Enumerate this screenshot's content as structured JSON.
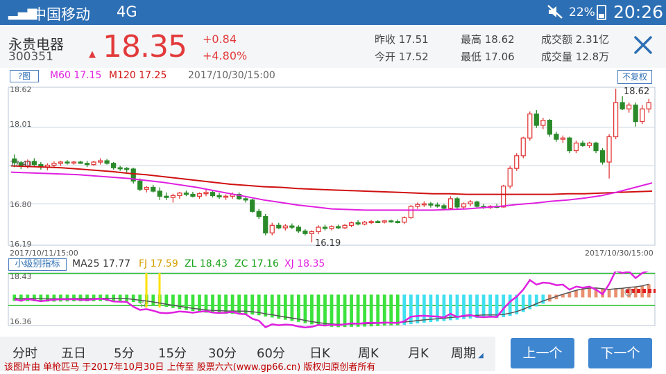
{
  "status_bar": {
    "carrier": "中国移动",
    "network": "4G",
    "battery_pct": "22%",
    "time": "20:26"
  },
  "stock": {
    "name": "永贵电器",
    "code": "300351",
    "price": "18.35",
    "change": "+0.84",
    "change_pct": "+4.80%",
    "prev_close_label": "昨收 17.51",
    "open_label": "今开 17.52",
    "high_label": "最高 18.62",
    "low_label": "最低 17.06",
    "turnover_label": "成交额 2.31亿",
    "volume_label": "成交量 12.8万"
  },
  "ma_bar": {
    "help_label": "?图",
    "m60_label": "M60",
    "m60_value": "17.15",
    "m120_label": "M120",
    "m120_value": "17.25",
    "date": "2017/10/30/15:00",
    "adjust_label": "不复权"
  },
  "main_chart": {
    "y_labels": [
      "18.62",
      "18.01",
      "17.40",
      "16.80",
      "16.19"
    ],
    "start_time": "2017/10/11/15:00",
    "end_time": "2017/10/30/15:00",
    "high_marker": "18.62",
    "low_marker": "16.19"
  },
  "indicator_bar": {
    "button_label": "小级别指标",
    "ma25_label": "MA25",
    "ma25_value": "17.77",
    "fj_label": "FJ",
    "fj_value": "17.59",
    "zl_label": "ZL",
    "zl_value": "18.43",
    "zc_label": "ZC",
    "zc_value": "17.16",
    "xj_label": "XJ",
    "xj_value": "18.35",
    "y_top": "18.43",
    "y_bottom": "16.36"
  },
  "tabs": [
    "分时",
    "五日",
    "5分",
    "15分",
    "30分",
    "60分",
    "日K",
    "周K",
    "月K",
    "周期"
  ],
  "buttons": {
    "prev": "上一个",
    "next": "下一个"
  },
  "watermark": "该图片由 单枪匹马 于2017年10月30日 上传至 股票六六(www.gp66.cn) 版权归原创者所有",
  "colors": {
    "up": "#e23a3a",
    "down": "#2a8a2a",
    "m60": "#e020e0",
    "m120": "#d01010",
    "brand": "#2d6fb4"
  },
  "chart_data": {
    "type": "candlestick",
    "interval": "60分",
    "ylim": [
      16.19,
      18.62
    ],
    "candles": [
      {
        "o": 17.51,
        "h": 17.58,
        "l": 17.38,
        "c": 17.45
      },
      {
        "o": 17.45,
        "h": 17.48,
        "l": 17.35,
        "c": 17.4
      },
      {
        "o": 17.4,
        "h": 17.5,
        "l": 17.36,
        "c": 17.47
      },
      {
        "o": 17.47,
        "h": 17.52,
        "l": 17.4,
        "c": 17.42
      },
      {
        "o": 17.42,
        "h": 17.46,
        "l": 17.34,
        "c": 17.38
      },
      {
        "o": 17.38,
        "h": 17.44,
        "l": 17.33,
        "c": 17.41
      },
      {
        "o": 17.41,
        "h": 17.47,
        "l": 17.38,
        "c": 17.44
      },
      {
        "o": 17.44,
        "h": 17.48,
        "l": 17.4,
        "c": 17.46
      },
      {
        "o": 17.46,
        "h": 17.49,
        "l": 17.42,
        "c": 17.45
      },
      {
        "o": 17.45,
        "h": 17.48,
        "l": 17.42,
        "c": 17.46
      },
      {
        "o": 17.46,
        "h": 17.48,
        "l": 17.43,
        "c": 17.44
      },
      {
        "o": 17.44,
        "h": 17.48,
        "l": 17.38,
        "c": 17.42
      },
      {
        "o": 17.42,
        "h": 17.48,
        "l": 17.4,
        "c": 17.46
      },
      {
        "o": 17.46,
        "h": 17.52,
        "l": 17.42,
        "c": 17.48
      },
      {
        "o": 17.48,
        "h": 17.51,
        "l": 17.42,
        "c": 17.44
      },
      {
        "o": 17.44,
        "h": 17.46,
        "l": 17.34,
        "c": 17.37
      },
      {
        "o": 17.37,
        "h": 17.4,
        "l": 17.32,
        "c": 17.36
      },
      {
        "o": 17.36,
        "h": 17.38,
        "l": 17.3,
        "c": 17.35
      },
      {
        "o": 17.35,
        "h": 17.37,
        "l": 17.12,
        "c": 17.16
      },
      {
        "o": 17.16,
        "h": 17.2,
        "l": 17.0,
        "c": 17.03
      },
      {
        "o": 17.03,
        "h": 17.08,
        "l": 16.98,
        "c": 17.06
      },
      {
        "o": 17.06,
        "h": 17.1,
        "l": 16.98,
        "c": 17.0
      },
      {
        "o": 17.0,
        "h": 17.06,
        "l": 16.86,
        "c": 16.92
      },
      {
        "o": 16.92,
        "h": 16.98,
        "l": 16.86,
        "c": 16.9
      },
      {
        "o": 16.9,
        "h": 16.96,
        "l": 16.82,
        "c": 16.93
      },
      {
        "o": 16.93,
        "h": 16.99,
        "l": 16.88,
        "c": 16.97
      },
      {
        "o": 16.97,
        "h": 17.01,
        "l": 16.92,
        "c": 16.95
      },
      {
        "o": 16.95,
        "h": 16.99,
        "l": 16.9,
        "c": 16.92
      },
      {
        "o": 16.92,
        "h": 16.98,
        "l": 16.88,
        "c": 16.96
      },
      {
        "o": 16.96,
        "h": 17.02,
        "l": 16.92,
        "c": 16.98
      },
      {
        "o": 16.98,
        "h": 17.0,
        "l": 16.9,
        "c": 16.93
      },
      {
        "o": 16.93,
        "h": 16.97,
        "l": 16.88,
        "c": 16.91
      },
      {
        "o": 16.91,
        "h": 16.95,
        "l": 16.86,
        "c": 16.92
      },
      {
        "o": 16.92,
        "h": 16.98,
        "l": 16.88,
        "c": 16.95
      },
      {
        "o": 16.95,
        "h": 16.98,
        "l": 16.86,
        "c": 16.88
      },
      {
        "o": 16.88,
        "h": 16.92,
        "l": 16.82,
        "c": 16.86
      },
      {
        "o": 16.86,
        "h": 16.88,
        "l": 16.66,
        "c": 16.68
      },
      {
        "o": 16.68,
        "h": 16.72,
        "l": 16.56,
        "c": 16.6
      },
      {
        "o": 16.6,
        "h": 16.64,
        "l": 16.3,
        "c": 16.34
      },
      {
        "o": 16.34,
        "h": 16.5,
        "l": 16.3,
        "c": 16.46
      },
      {
        "o": 16.46,
        "h": 16.5,
        "l": 16.4,
        "c": 16.42
      },
      {
        "o": 16.42,
        "h": 16.48,
        "l": 16.38,
        "c": 16.45
      },
      {
        "o": 16.45,
        "h": 16.49,
        "l": 16.4,
        "c": 16.43
      },
      {
        "o": 16.43,
        "h": 16.46,
        "l": 16.34,
        "c": 16.37
      },
      {
        "o": 16.37,
        "h": 16.4,
        "l": 16.3,
        "c": 16.33
      },
      {
        "o": 16.33,
        "h": 16.38,
        "l": 16.19,
        "c": 16.36
      },
      {
        "o": 16.36,
        "h": 16.46,
        "l": 16.32,
        "c": 16.43
      },
      {
        "o": 16.43,
        "h": 16.47,
        "l": 16.38,
        "c": 16.41
      },
      {
        "o": 16.41,
        "h": 16.46,
        "l": 16.38,
        "c": 16.44
      },
      {
        "o": 16.44,
        "h": 16.47,
        "l": 16.4,
        "c": 16.42
      },
      {
        "o": 16.42,
        "h": 16.48,
        "l": 16.4,
        "c": 16.46
      },
      {
        "o": 16.46,
        "h": 16.52,
        "l": 16.43,
        "c": 16.5
      },
      {
        "o": 16.5,
        "h": 16.54,
        "l": 16.46,
        "c": 16.48
      },
      {
        "o": 16.48,
        "h": 16.53,
        "l": 16.46,
        "c": 16.51
      },
      {
        "o": 16.51,
        "h": 16.54,
        "l": 16.48,
        "c": 16.52
      },
      {
        "o": 16.52,
        "h": 16.54,
        "l": 16.5,
        "c": 16.51
      },
      {
        "o": 16.51,
        "h": 16.54,
        "l": 16.49,
        "c": 16.53
      },
      {
        "o": 16.53,
        "h": 16.55,
        "l": 16.5,
        "c": 16.52
      },
      {
        "o": 16.52,
        "h": 16.55,
        "l": 16.49,
        "c": 16.51
      },
      {
        "o": 16.51,
        "h": 16.6,
        "l": 16.48,
        "c": 16.58
      },
      {
        "o": 16.58,
        "h": 16.78,
        "l": 16.56,
        "c": 16.76
      },
      {
        "o": 16.76,
        "h": 16.82,
        "l": 16.72,
        "c": 16.79
      },
      {
        "o": 16.79,
        "h": 16.84,
        "l": 16.75,
        "c": 16.8
      },
      {
        "o": 16.8,
        "h": 16.83,
        "l": 16.74,
        "c": 16.78
      },
      {
        "o": 16.78,
        "h": 16.82,
        "l": 16.74,
        "c": 16.77
      },
      {
        "o": 16.77,
        "h": 16.8,
        "l": 16.7,
        "c": 16.73
      },
      {
        "o": 16.73,
        "h": 16.92,
        "l": 16.7,
        "c": 16.88
      },
      {
        "o": 16.88,
        "h": 16.91,
        "l": 16.72,
        "c": 16.75
      },
      {
        "o": 16.75,
        "h": 16.82,
        "l": 16.72,
        "c": 16.8
      },
      {
        "o": 16.8,
        "h": 16.86,
        "l": 16.76,
        "c": 16.83
      },
      {
        "o": 16.83,
        "h": 16.85,
        "l": 16.74,
        "c": 16.76
      },
      {
        "o": 16.76,
        "h": 16.8,
        "l": 16.72,
        "c": 16.74
      },
      {
        "o": 16.74,
        "h": 16.78,
        "l": 16.72,
        "c": 16.76
      },
      {
        "o": 16.76,
        "h": 16.8,
        "l": 16.73,
        "c": 16.75
      },
      {
        "o": 16.75,
        "h": 17.1,
        "l": 16.74,
        "c": 17.08
      },
      {
        "o": 17.08,
        "h": 17.4,
        "l": 17.04,
        "c": 17.36
      },
      {
        "o": 17.36,
        "h": 17.6,
        "l": 17.32,
        "c": 17.56
      },
      {
        "o": 17.56,
        "h": 17.86,
        "l": 17.52,
        "c": 17.84
      },
      {
        "o": 17.84,
        "h": 18.26,
        "l": 17.8,
        "c": 18.22
      },
      {
        "o": 18.22,
        "h": 18.28,
        "l": 18.0,
        "c": 18.04
      },
      {
        "o": 18.04,
        "h": 18.16,
        "l": 17.98,
        "c": 18.12
      },
      {
        "o": 18.12,
        "h": 18.14,
        "l": 17.86,
        "c": 17.9
      },
      {
        "o": 17.9,
        "h": 17.94,
        "l": 17.78,
        "c": 17.82
      },
      {
        "o": 17.82,
        "h": 17.88,
        "l": 17.76,
        "c": 17.84
      },
      {
        "o": 17.84,
        "h": 17.86,
        "l": 17.6,
        "c": 17.64
      },
      {
        "o": 17.64,
        "h": 17.8,
        "l": 17.6,
        "c": 17.76
      },
      {
        "o": 17.76,
        "h": 17.8,
        "l": 17.7,
        "c": 17.72
      },
      {
        "o": 17.72,
        "h": 17.78,
        "l": 17.68,
        "c": 17.76
      },
      {
        "o": 17.76,
        "h": 17.78,
        "l": 17.6,
        "c": 17.64
      },
      {
        "o": 17.64,
        "h": 17.68,
        "l": 17.42,
        "c": 17.46
      },
      {
        "o": 17.46,
        "h": 17.9,
        "l": 17.2,
        "c": 17.86
      },
      {
        "o": 17.86,
        "h": 18.62,
        "l": 17.82,
        "c": 18.4
      },
      {
        "o": 18.4,
        "h": 18.5,
        "l": 18.28,
        "c": 18.3
      },
      {
        "o": 18.3,
        "h": 18.4,
        "l": 18.24,
        "c": 18.36
      },
      {
        "o": 18.36,
        "h": 18.4,
        "l": 18.02,
        "c": 18.1
      },
      {
        "o": 18.1,
        "h": 18.36,
        "l": 18.06,
        "c": 18.3
      },
      {
        "o": 18.3,
        "h": 18.46,
        "l": 18.24,
        "c": 18.4
      }
    ],
    "m60": [
      17.3,
      17.29,
      17.28,
      17.27,
      17.26,
      17.24,
      17.22,
      17.2,
      17.17,
      17.14,
      17.1,
      17.06,
      17.01,
      16.96,
      16.91,
      16.86,
      16.82,
      16.78,
      16.75,
      16.72,
      16.71,
      16.7,
      16.7,
      16.7,
      16.7,
      16.7,
      16.71,
      16.72,
      16.74,
      16.76,
      16.79,
      16.81,
      16.84,
      16.86,
      16.89,
      16.93,
      16.99,
      17.06,
      17.13
    ],
    "m120": [
      17.4,
      17.39,
      17.38,
      17.37,
      17.35,
      17.33,
      17.31,
      17.28,
      17.26,
      17.23,
      17.2,
      17.17,
      17.14,
      17.11,
      17.09,
      17.07,
      17.06,
      17.04,
      17.03,
      17.02,
      17.01,
      17.0,
      16.99,
      16.98,
      16.97,
      16.96,
      16.96,
      16.95,
      16.95,
      16.95,
      16.95,
      16.95,
      16.95,
      16.96,
      16.96,
      16.97,
      16.98,
      16.99,
      17.0
    ]
  }
}
